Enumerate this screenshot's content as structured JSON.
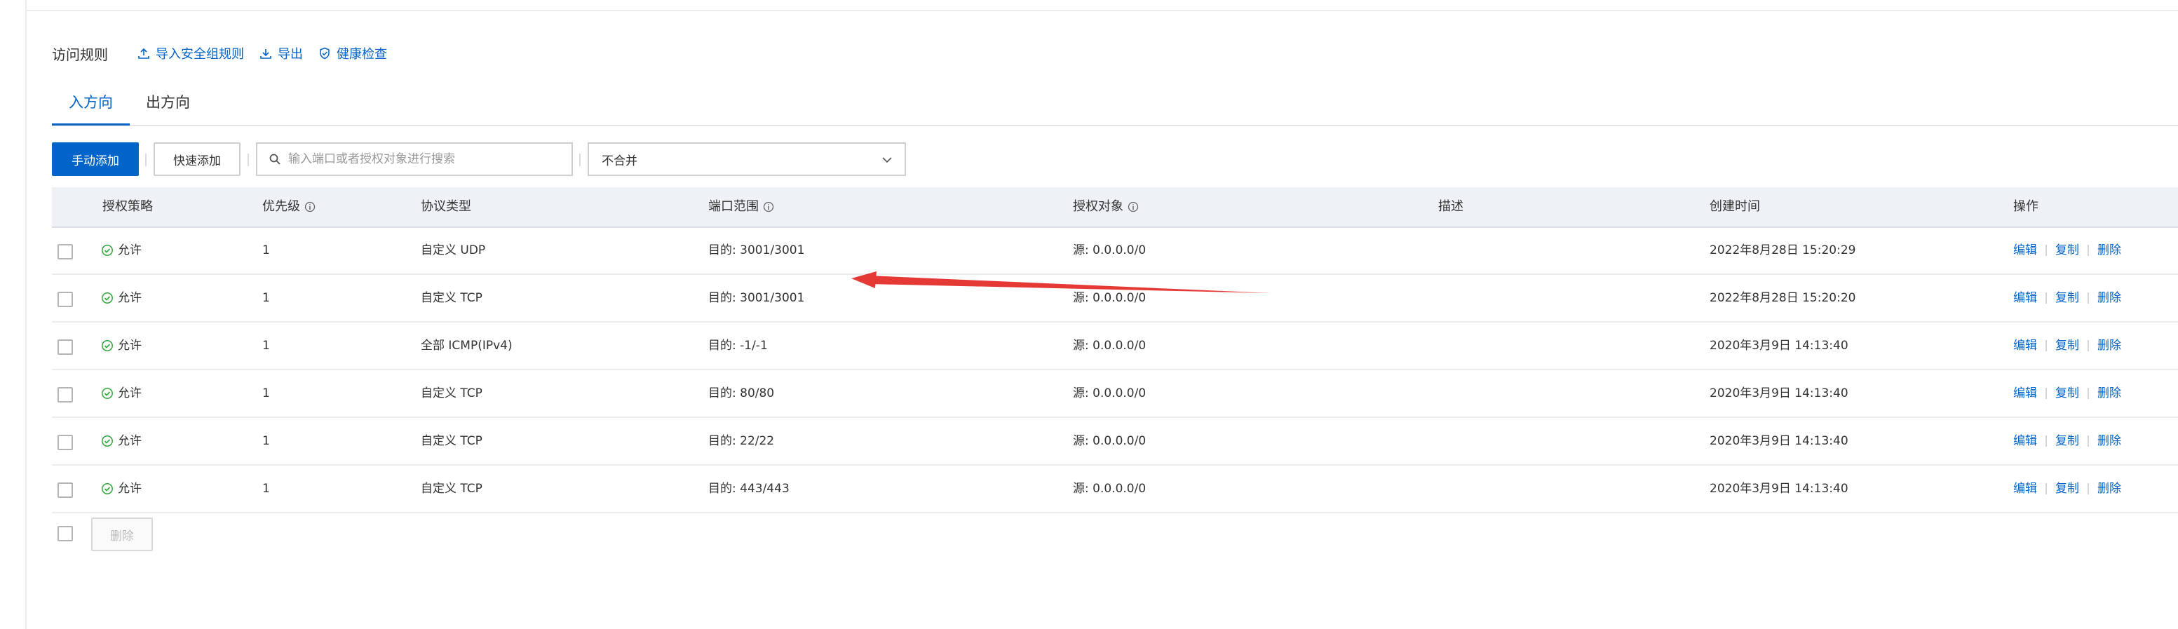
{
  "header": {
    "title": "访问规则",
    "links": [
      {
        "label": "导入安全组规则",
        "icon": "import-icon"
      },
      {
        "label": "导出",
        "icon": "export-icon"
      },
      {
        "label": "健康检查",
        "icon": "shield-check-icon"
      }
    ]
  },
  "tabs": [
    {
      "label": "入方向",
      "active": true
    },
    {
      "label": "出方向",
      "active": false
    }
  ],
  "toolbar": {
    "manual_add": "手动添加",
    "quick_add": "快速添加",
    "search_placeholder": "输入端口或者授权对象进行搜索",
    "merge_select": "不合并"
  },
  "table": {
    "columns": {
      "policy": "授权策略",
      "priority": "优先级",
      "protocol": "协议类型",
      "port_range": "端口范围",
      "auth_object": "授权对象",
      "description": "描述",
      "created": "创建时间",
      "actions": "操作"
    },
    "rows": [
      {
        "policy": "允许",
        "priority": "1",
        "protocol": "自定义 UDP",
        "port": "目的: 3001/3001",
        "source": "源: 0.0.0.0/0",
        "description": "",
        "created": "2022年8月28日 15:20:29"
      },
      {
        "policy": "允许",
        "priority": "1",
        "protocol": "自定义 TCP",
        "port": "目的: 3001/3001",
        "source": "源: 0.0.0.0/0",
        "description": "",
        "created": "2022年8月28日 15:20:20"
      },
      {
        "policy": "允许",
        "priority": "1",
        "protocol": "全部 ICMP(IPv4)",
        "port": "目的: -1/-1",
        "source": "源: 0.0.0.0/0",
        "description": "",
        "created": "2020年3月9日 14:13:40"
      },
      {
        "policy": "允许",
        "priority": "1",
        "protocol": "自定义 TCP",
        "port": "目的: 80/80",
        "source": "源: 0.0.0.0/0",
        "description": "",
        "created": "2020年3月9日 14:13:40"
      },
      {
        "policy": "允许",
        "priority": "1",
        "protocol": "自定义 TCP",
        "port": "目的: 22/22",
        "source": "源: 0.0.0.0/0",
        "description": "",
        "created": "2020年3月9日 14:13:40"
      },
      {
        "policy": "允许",
        "priority": "1",
        "protocol": "自定义 TCP",
        "port": "目的: 443/443",
        "source": "源: 0.0.0.0/0",
        "description": "",
        "created": "2020年3月9日 14:13:40"
      }
    ],
    "actions": {
      "edit": "编辑",
      "copy": "复制",
      "delete": "删除"
    }
  },
  "footer": {
    "delete_label": "删除"
  },
  "colors": {
    "accent": "#0064c8",
    "allow_green": "#2fa73a",
    "annotation_red": "#e53935"
  }
}
